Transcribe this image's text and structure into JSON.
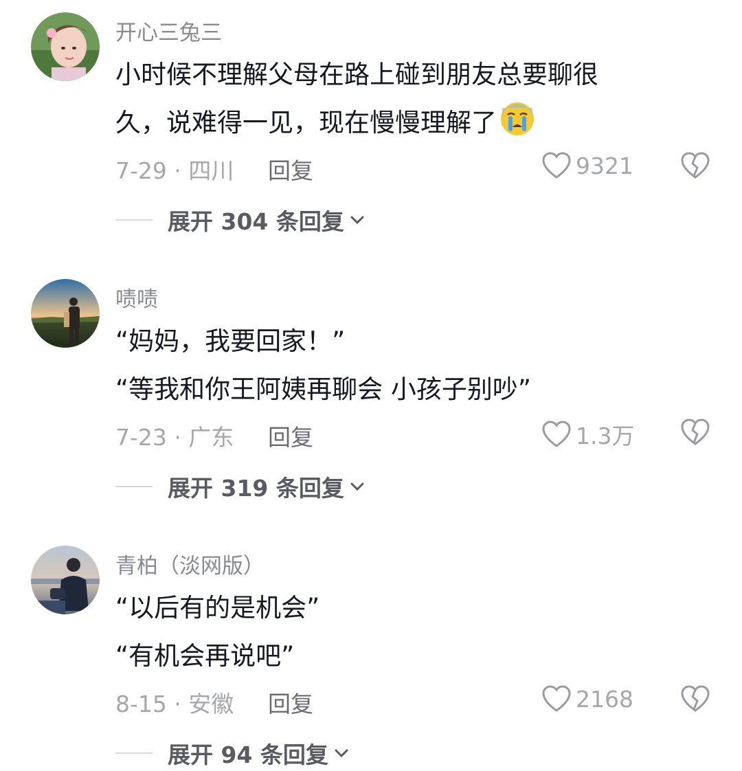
{
  "comments": [
    {
      "username": "开心三兔三",
      "lines": [
        "小时候不理解父母在路上碰到朋友总要聊很",
        "久，说难得一见，现在慢慢理解了"
      ],
      "emoji": "crying-face-icon",
      "date_location": "7-29 · 四川",
      "reply_label": "回复",
      "likes": "9321",
      "expand_label": "展开 304 条回复"
    },
    {
      "username": "啧啧",
      "lines": [
        "“妈妈，我要回家！”",
        "“等我和你王阿姨再聊会 小孩子别吵”"
      ],
      "date_location": "7-23 · 广东",
      "reply_label": "回复",
      "likes": "1.3万",
      "expand_label": "展开 319 条回复"
    },
    {
      "username": "青柏（淡网版）",
      "lines": [
        "“以后有的是机会”",
        "“有机会再说吧”"
      ],
      "date_location": "8-15 · 安徽",
      "reply_label": "回复",
      "likes": "2168",
      "expand_label": "展开 94 条回复"
    }
  ],
  "colors": {
    "username": "#8a8b91",
    "text": "#161823",
    "meta": "#a6a7ab",
    "expand": "#5a5b62"
  }
}
